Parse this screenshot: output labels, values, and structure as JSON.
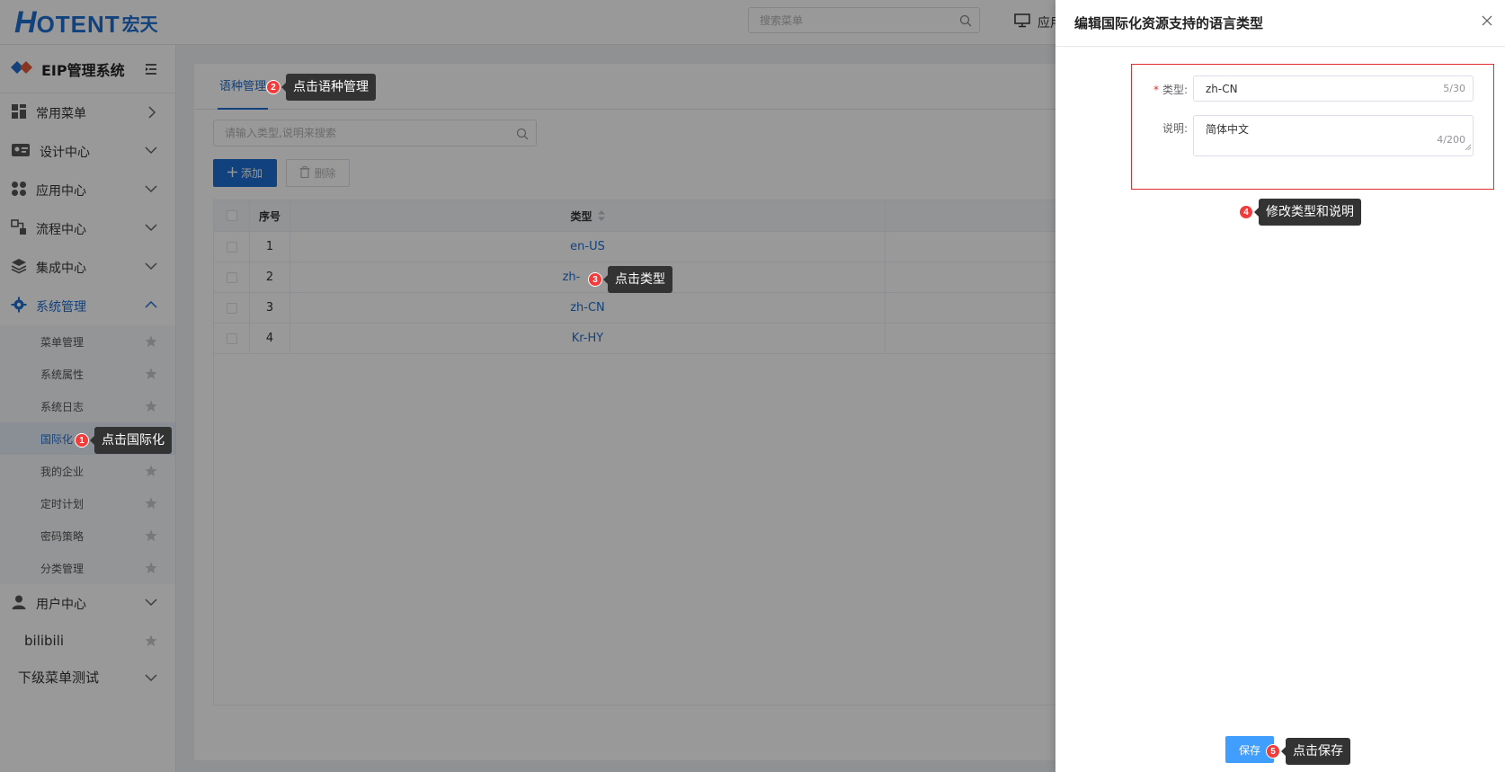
{
  "header": {
    "logo_main": "OTENT",
    "logo_h": "H",
    "logo_cn": "宏天",
    "search_placeholder": "搜索菜单",
    "nav_label": "应用"
  },
  "sidebar": {
    "system_title": "EIP管理系统",
    "menus": [
      {
        "label": "常用菜单"
      },
      {
        "label": "设计中心"
      },
      {
        "label": "应用中心"
      },
      {
        "label": "流程中心"
      },
      {
        "label": "集成中心"
      },
      {
        "label": "系统管理"
      }
    ],
    "sub_items": [
      {
        "label": "菜单管理"
      },
      {
        "label": "系统属性"
      },
      {
        "label": "系统日志"
      },
      {
        "label": "国际化"
      },
      {
        "label": "我的企业"
      },
      {
        "label": "定时计划"
      },
      {
        "label": "密码策略"
      },
      {
        "label": "分类管理"
      }
    ],
    "bottom_menus": [
      {
        "label": "用户中心"
      },
      {
        "label": "bilibili"
      },
      {
        "label": "下级菜单测试"
      }
    ]
  },
  "main": {
    "tab_label": "语种管理",
    "search_placeholder": "请输入类型,说明来搜索",
    "add_label": "添加",
    "delete_label": "删除",
    "columns": {
      "no": "序号",
      "type": "类型"
    },
    "rows": [
      {
        "no": "1",
        "type": "en-US"
      },
      {
        "no": "2",
        "type": "zh-"
      },
      {
        "no": "3",
        "type": "zh-CN"
      },
      {
        "no": "4",
        "type": "Kr-HY"
      }
    ]
  },
  "drawer": {
    "title": "编辑国际化资源支持的语言类型",
    "type_label": "类型:",
    "type_value": "zh-CN",
    "type_counter": "5/30",
    "desc_label": "说明:",
    "desc_value": "简体中文",
    "desc_counter": "4/200",
    "save_label": "保存"
  },
  "annotations": [
    {
      "num": "1",
      "text": "点击国际化"
    },
    {
      "num": "2",
      "text": "点击语种管理"
    },
    {
      "num": "3",
      "text": "点击类型"
    },
    {
      "num": "4",
      "text": "修改类型和说明"
    },
    {
      "num": "5",
      "text": "点击保存"
    }
  ],
  "colors": {
    "brand": "#1f6fd0",
    "save_button": "#409eff",
    "highlight_border": "#e02e2e",
    "step_badge": "#f23c3c"
  }
}
